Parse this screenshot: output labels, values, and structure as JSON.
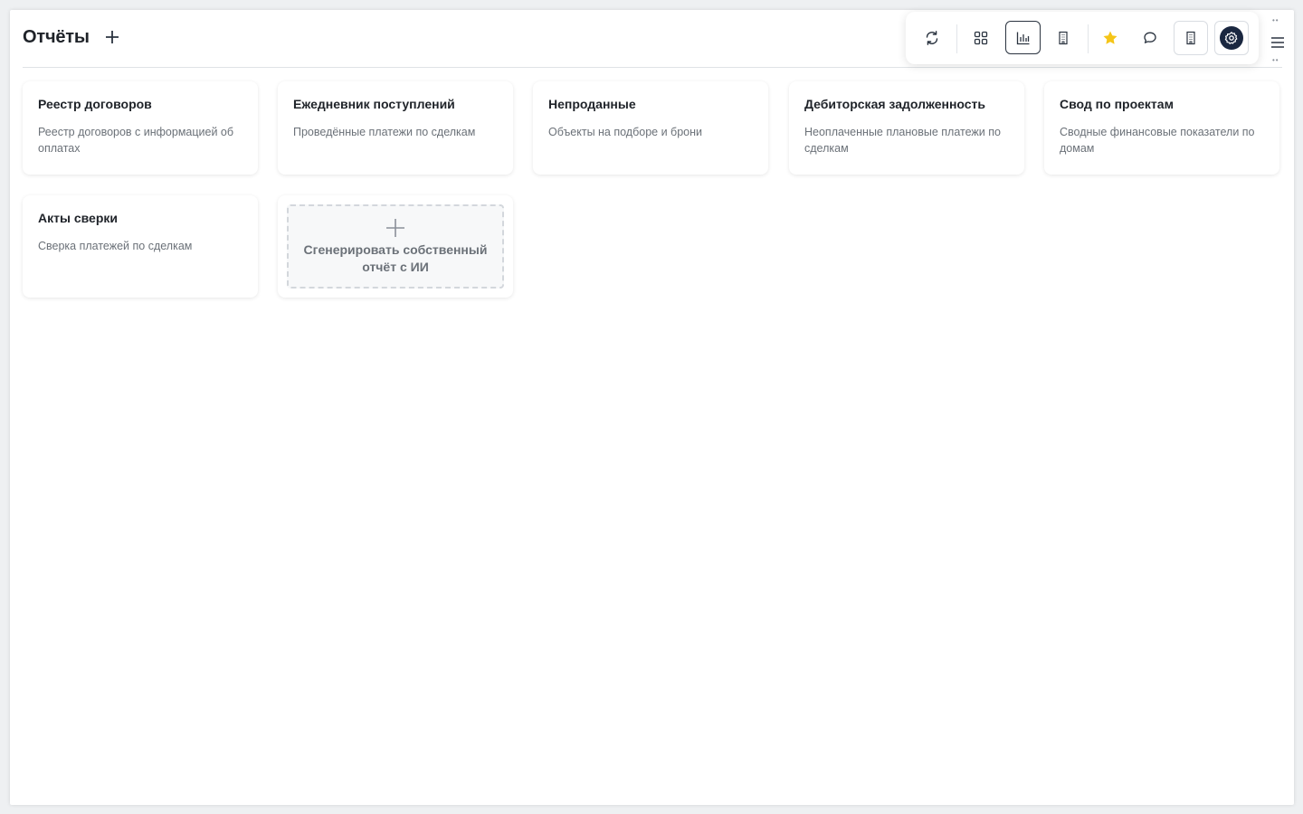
{
  "header": {
    "title": "Отчёты"
  },
  "toolbar": {
    "buttons": [
      {
        "name": "refresh-icon",
        "active": false
      },
      {
        "name": "grid-icon",
        "active": false
      },
      {
        "name": "bar-chart-icon",
        "active": true
      },
      {
        "name": "building-icon",
        "active": false
      },
      {
        "name": "star-icon",
        "active": false
      },
      {
        "name": "chat-icon",
        "active": false
      },
      {
        "name": "building-icon",
        "active": false
      },
      {
        "name": "settings-icon",
        "active": false
      }
    ],
    "accent_star_color": "#f5c518",
    "settings_bg_color": "#1a2740"
  },
  "reports": [
    {
      "title": "Реестр договоров",
      "description": "Реестр договоров с информацией об оплатах"
    },
    {
      "title": "Ежедневник поступлений",
      "description": "Проведённые платежи по сделкам"
    },
    {
      "title": "Непроданные",
      "description": "Объекты на подборе и брони"
    },
    {
      "title": "Дебиторская задолженность",
      "description": "Неоплаченные плановые платежи по сделкам"
    },
    {
      "title": "Свод по проектам",
      "description": "Сводные финансовые показатели по домам"
    },
    {
      "title": "Акты сверки",
      "description": "Сверка платежей по сделкам"
    }
  ],
  "generate_card": {
    "label": "Сгенерировать собственный отчёт с ИИ"
  }
}
